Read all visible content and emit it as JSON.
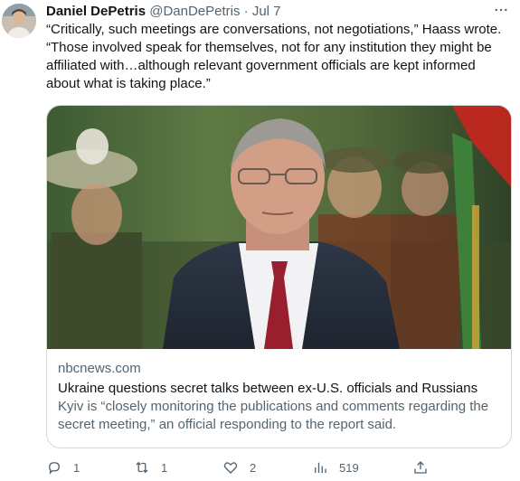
{
  "author": {
    "name": "Daniel DePetris",
    "handle": "@DanDePetris",
    "separator": "·",
    "date": "Jul 7"
  },
  "more_icon": "more-horizontal-icon",
  "tweet_text": "“Critically, such meetings are conversations, not negotiations,” Haass wrote. “Those involved speak for themselves, not for any institution they might be affiliated with…although relevant government officials are kept informed about what is taking place.”",
  "card": {
    "domain": "nbcnews.com",
    "title": "Ukraine questions secret talks between ex-U.S. officials and Russians",
    "description": "Kyiv is “closely monitoring the publications and comments regarding the secret meeting,” an official responding to the report said."
  },
  "actions": {
    "reply_count": "1",
    "retweet_count": "1",
    "like_count": "2",
    "views_count": "519"
  },
  "colors": {
    "text_primary": "#0f1419",
    "text_secondary": "#536471",
    "border": "#cfd9de"
  }
}
